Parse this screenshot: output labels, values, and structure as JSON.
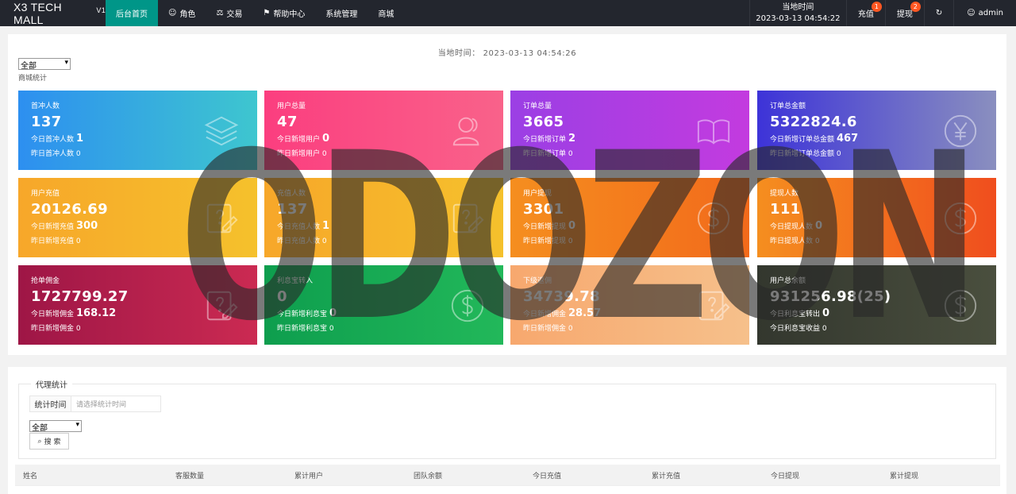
{
  "app": {
    "brand": "X3 TECH MALL",
    "brand_sup": "V1"
  },
  "nav": [
    {
      "label": "后台首页",
      "icon": "",
      "active": true
    },
    {
      "label": "角色",
      "icon": "user-icon"
    },
    {
      "label": "交易",
      "icon": "scale-icon"
    },
    {
      "label": "帮助中心",
      "icon": "flag-icon"
    },
    {
      "label": "系统管理",
      "icon": ""
    },
    {
      "label": "商城",
      "icon": ""
    }
  ],
  "topright": {
    "time_label": "当地时间",
    "time_value": "2023-03-13 04:54:22",
    "recharge": "充值",
    "recharge_badge": "1",
    "withdraw": "提现",
    "withdraw_badge": "2",
    "refresh_icon": "refresh-icon",
    "user": "admin"
  },
  "overview": {
    "local_time": "当地时间： 2023-03-13 04:54:26",
    "select_value": "全部",
    "section_label": "商城统计"
  },
  "cards": [
    {
      "title": "首冲人数",
      "value": "137",
      "r1_label": "今日首冲人数",
      "r1_value": "1",
      "r2_label": "昨日首冲人数",
      "r2_value": "0",
      "icon": "layers-icon",
      "color_from": "#2d8ff0",
      "color_to": "#3ec6cf"
    },
    {
      "title": "用户总量",
      "value": "47",
      "r1_label": "今日新增用户",
      "r1_value": "0",
      "r2_label": "昨日新增用户",
      "r2_value": "0",
      "icon": "users-icon",
      "color_from": "#fb3e7f",
      "color_to": "#f9628a"
    },
    {
      "title": "订单总量",
      "value": "3665",
      "r1_label": "今日新增订单",
      "r1_value": "2",
      "r2_label": "昨日新增订单",
      "r2_value": "0",
      "icon": "book-icon",
      "color_from": "#9b3fe4",
      "color_to": "#c33bdf"
    },
    {
      "title": "订单总金额",
      "value": "5322824.6",
      "r1_label": "今日新增订单总金额",
      "r1_value": "467",
      "r2_label": "昨日新增订单总金额",
      "r2_value": "0",
      "icon": "yen-icon",
      "color_from": "#3d33d8",
      "color_to": "#8a8fbf"
    },
    {
      "title": "用户充值",
      "value": "20126.69",
      "r1_label": "今日新增充值",
      "r1_value": "300",
      "r2_label": "昨日新增充值",
      "r2_value": "0",
      "icon": "edit-icon",
      "color_from": "#f7a72a",
      "color_to": "#f5c12c"
    },
    {
      "title": "充值人数",
      "value": "137",
      "r1_label": "今日充值人数",
      "r1_value": "1",
      "r2_label": "昨日充值人数",
      "r2_value": "0",
      "icon": "edit-icon",
      "color_from": "#f7a72a",
      "color_to": "#f5c12c"
    },
    {
      "title": "用户提现",
      "value": "3301",
      "r1_label": "今日新增提现",
      "r1_value": "0",
      "r2_label": "昨日新增提现",
      "r2_value": "0",
      "icon": "dollar-icon",
      "color_from": "#f58e1f",
      "color_to": "#f26a1b"
    },
    {
      "title": "提现人数",
      "value": "111",
      "r1_label": "今日提现人数",
      "r1_value": "0",
      "r2_label": "昨日提现人数",
      "r2_value": "0",
      "icon": "dollar-icon",
      "color_from": "#f58e1f",
      "color_to": "#f04e1e"
    },
    {
      "title": "抢单佣金",
      "value": "1727799.27",
      "r1_label": "今日新增佣金",
      "r1_value": "168.12",
      "r2_label": "昨日新增佣金",
      "r2_value": "0",
      "icon": "edit-icon",
      "color_from": "#9e1646",
      "color_to": "#cb2a52"
    },
    {
      "title": "利息宝转入",
      "value": "0",
      "r1_label": "今日新增利息宝",
      "r1_value": "0",
      "r2_label": "昨日新增利息宝",
      "r2_value": "0",
      "icon": "dollar-icon",
      "color_from": "#0e9e4e",
      "color_to": "#22b85a"
    },
    {
      "title": "下级返佣",
      "value": "34739.78",
      "r1_label": "今日新增佣金",
      "r1_value": "28.57",
      "r2_label": "昨日新增佣金",
      "r2_value": "0",
      "icon": "edit-icon",
      "color_from": "#f7a86e",
      "color_to": "#f6c08b"
    },
    {
      "title": "用户总余额",
      "value": "931256.98(25)",
      "r1_label": "今日利息宝转出",
      "r1_value": "0",
      "r2_label": "今日利息宝收益",
      "r2_value": "0",
      "icon": "dollar-icon",
      "color_from": "#33372e",
      "color_to": "#4a4f3e"
    }
  ],
  "watermark": "ODOZON",
  "agent": {
    "legend": "代理统计",
    "time_label": "统计时间",
    "time_placeholder": "请选择统计时间",
    "select_value": "全部",
    "search_label": "搜 索",
    "search_icon": "search-icon"
  },
  "table": {
    "columns": [
      "姓名",
      "客服数量",
      "累计用户",
      "团队余额",
      "今日充值",
      "累计充值",
      "今日提现",
      "累计提现"
    ]
  }
}
